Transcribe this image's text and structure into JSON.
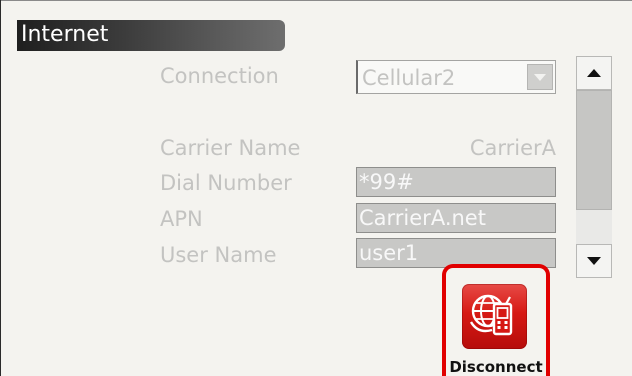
{
  "window": {
    "title": "Internet"
  },
  "form": {
    "connection_label": "Connection",
    "connection_value": "Cellular2",
    "carrier_name_label": "Carrier Name",
    "carrier_name_value": "CarrierA",
    "dial_number_label": "Dial Number",
    "dial_number_value": "*99#",
    "apn_label": "APN",
    "apn_value": "CarrierA.net",
    "user_name_label": "User Name",
    "user_name_value": "user1"
  },
  "actions": {
    "disconnect_label": "Disconnect",
    "disconnect_icon": "network-phone-icon"
  },
  "colors": {
    "highlight": "#e10000",
    "button_red": "#d61914",
    "disabled_text": "#c3c3c1"
  }
}
